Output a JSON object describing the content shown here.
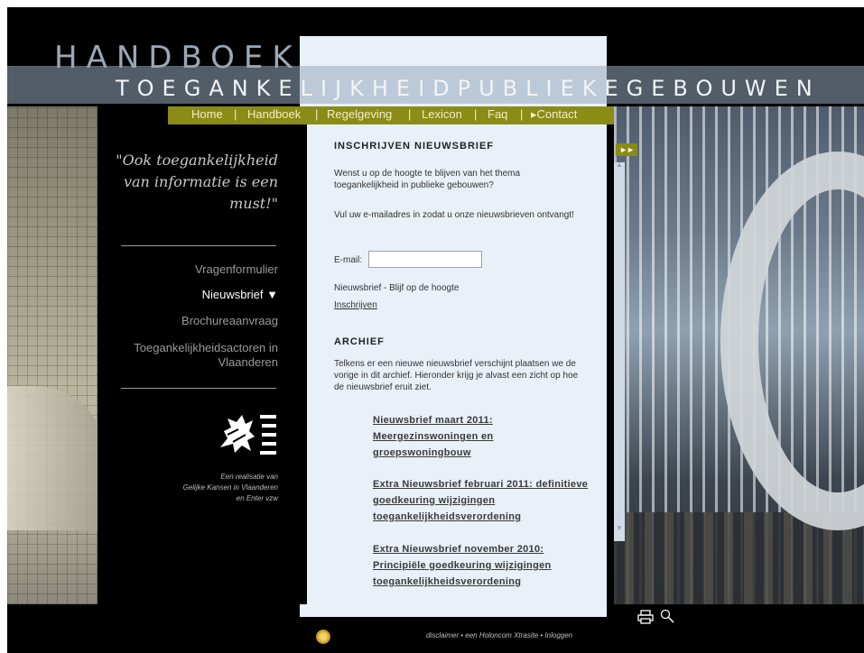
{
  "header": {
    "logo_top": "HANDBOEK",
    "logo_sub": "TOEGANKELIJKHEIDPUBLIEKEGEBOUWEN"
  },
  "nav": {
    "items": [
      "Home",
      "Handboek",
      "Regelgeving",
      "Lexicon",
      "Faq",
      "▸Contact"
    ],
    "separator": "|"
  },
  "sidebar": {
    "quote": "\"Ook toegankelijkheid van informatie is een must!\"",
    "links": [
      {
        "label": "Vragenformulier",
        "active": false
      },
      {
        "label": "Nieuwsbrief ▼",
        "active": true
      },
      {
        "label": "Brochureaanvraag",
        "active": false
      },
      {
        "label": "Toegankelijkheidsactoren in Vlaanderen",
        "active": false
      }
    ],
    "credit_lines": [
      "Een realisatie van",
      "Gelijke Kansen in Vlaanderen",
      "en Enter vzw"
    ]
  },
  "main": {
    "subscribe": {
      "heading": "INSCHRIJVEN NIEUWSBRIEF",
      "intro": "Wenst u op de hoogte te blijven van het thema toegankelijkheid in publieke gebouwen?",
      "instruction": "Vul uw e-mailadres in zodat u onze nieuwsbrieven ontvangt!",
      "email_label": "E-mail:",
      "email_value": "",
      "newsletter_label": "Nieuwsbrief - Blijf op de hoogte",
      "subscribe_link": "Inschrijven"
    },
    "archive": {
      "heading": "ARCHIEF",
      "intro": "Telkens er een nieuwe nieuwsbrief verschijnt plaatsen we de vorige in dit archief. Hieronder krijg je alvast een zicht op hoe de nieuwsbrief eruit ziet.",
      "items": [
        "Nieuwsbrief maart 2011: Meergezinswoningen en groepswoningbouw",
        "Extra Nieuwsbrief februari 2011: definitieve goedkeuring wijzigingen toegankelijkheidsverordening",
        "Extra Nieuwsbrief november 2010: Principiële goedkeuring wijzigingen toegankelijkheidsverordening"
      ]
    }
  },
  "footer": {
    "links": "disclaimer  •  een Holoncom Xtrasite  •  Inloggen"
  },
  "icons": {
    "forward": "fast-forward-icon",
    "print": "print-icon",
    "search": "search-icon",
    "lion": "flemish-lion-icon"
  }
}
